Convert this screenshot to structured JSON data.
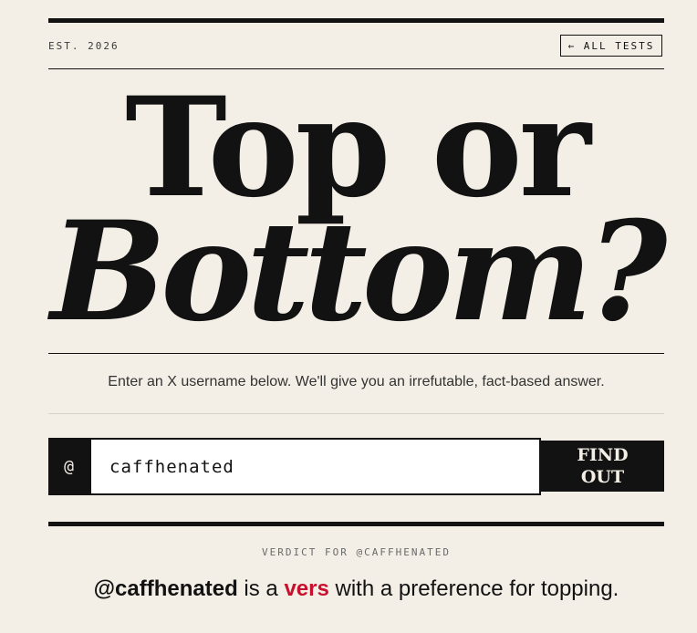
{
  "header": {
    "established": "EST. 2026",
    "all_tests_label": "← ALL TESTS"
  },
  "title": {
    "line1": "Top or",
    "line2": "Bottom?"
  },
  "instructions": "Enter an X username below. We'll give you an irrefutable, fact-based answer.",
  "form": {
    "at_symbol": "@",
    "username_value": "caffhenated",
    "submit_label": "FIND OUT"
  },
  "verdict": {
    "label": "VERDICT FOR @CAFFHENATED",
    "handle": "@caffhenated",
    "connector": "is a",
    "type": "vers",
    "rest": "with a preference for topping."
  },
  "colors": {
    "background": "#f4efe6",
    "ink": "#121212",
    "accent": "#c8102e"
  }
}
